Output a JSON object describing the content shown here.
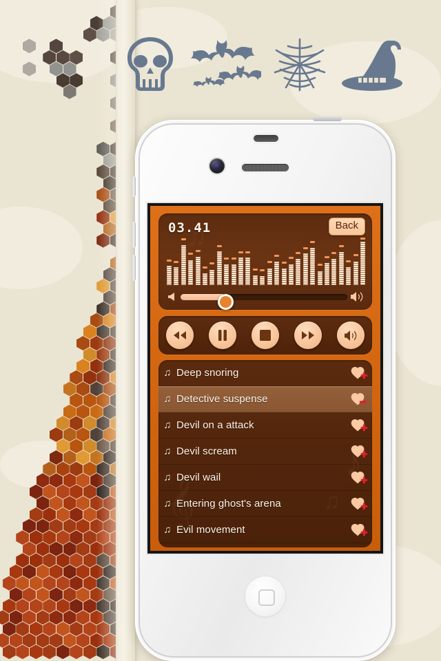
{
  "background": {
    "base_color": "#eae4d2",
    "hex_pattern_name": "honeycomb-hexagon-pattern",
    "decor_icons": [
      {
        "name": "skull-icon",
        "label": "Skull"
      },
      {
        "name": "bats-icon",
        "label": "Bats"
      },
      {
        "name": "spiderweb-icon",
        "label": "Spider web"
      },
      {
        "name": "witch-hat-icon",
        "label": "Witch hat"
      }
    ],
    "icon_color": "#667a90"
  },
  "device": {
    "name": "iphone-white",
    "camera": "front-camera",
    "speaker": "earpiece-speaker",
    "home_button": "home-button"
  },
  "app": {
    "accent_color": "#d96a18",
    "panel_color": "#5d2c10",
    "highlight_color": "#93603a",
    "cream_color": "#fdeedd",
    "player": {
      "timer": "03.41",
      "back_label": "Back",
      "slider": {
        "name": "volume-slider",
        "value_percent": 27,
        "left_icon": "speaker-low-icon",
        "right_icon": "speaker-high-icon"
      },
      "equalizer": {
        "name": "audio-equalizer",
        "bar_count": 28,
        "levels": [
          42,
          39,
          88,
          55,
          62,
          26,
          34,
          74,
          45,
          45,
          60,
          60,
          21,
          19,
          37,
          52,
          36,
          46,
          58,
          69,
          82,
          31,
          48,
          57,
          73,
          39,
          52,
          96
        ],
        "peaks": [
          52,
          49,
          98,
          66,
          72,
          37,
          45,
          84,
          56,
          56,
          70,
          70,
          32,
          30,
          48,
          62,
          47,
          57,
          68,
          79,
          92,
          42,
          59,
          68,
          83,
          50,
          63,
          100
        ]
      }
    },
    "controls": [
      {
        "name": "rewind-button",
        "icon": "rewind-icon"
      },
      {
        "name": "pause-button",
        "icon": "pause-icon"
      },
      {
        "name": "stop-button",
        "icon": "stop-icon"
      },
      {
        "name": "forward-button",
        "icon": "forward-icon"
      },
      {
        "name": "volume-button",
        "icon": "speaker-icon"
      }
    ],
    "tracks": [
      {
        "title": "Deep snoring",
        "selected": false,
        "fav_action": "add",
        "note_icon": "music-note-icon"
      },
      {
        "title": "Detective suspense",
        "selected": true,
        "fav_action": "remove",
        "note_icon": "music-note-icon"
      },
      {
        "title": "Devil on a attack",
        "selected": false,
        "fav_action": "add",
        "note_icon": "music-note-icon"
      },
      {
        "title": "Devil scream",
        "selected": false,
        "fav_action": "add",
        "note_icon": "music-note-icon"
      },
      {
        "title": "Devil wail",
        "selected": false,
        "fav_action": "add",
        "note_icon": "music-note-icon"
      },
      {
        "title": "Entering ghost's arena",
        "selected": false,
        "fav_action": "add",
        "note_icon": "music-note-icon"
      },
      {
        "title": "Evil movement",
        "selected": false,
        "fav_action": "add",
        "note_icon": "music-note-icon"
      }
    ],
    "note_glyph": "♫",
    "heart_color": "#fbc9a2",
    "badge_color": "#e0202a"
  }
}
